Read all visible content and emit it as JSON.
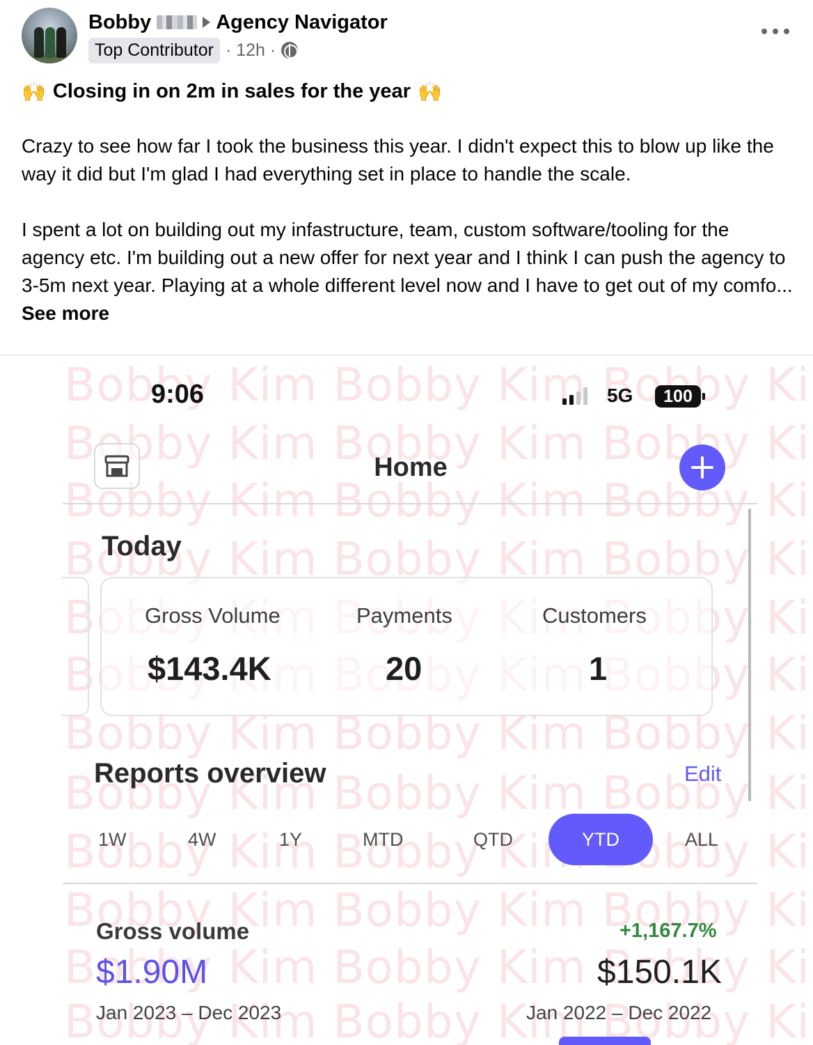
{
  "post": {
    "author": "Bobby",
    "group": "Agency Navigator",
    "badge": "Top Contributor",
    "time": "· 12h ·",
    "title": "Closing in on 2m in sales for the year",
    "title_emoji": "🙌",
    "paragraph1": "Crazy to see how far I took the business this year. I didn't expect this to blow up like the way it did but I'm glad I had everything set in place to handle the scale.",
    "paragraph2": "I spent a lot on building out my infastructure, team, custom software/tooling for the agency etc. I'm building out a new offer for next year and I think I can push the agency to 3-5m next year. Playing at a whole different level now and I have to get out of my comfo...",
    "see_more": "See more"
  },
  "screenshot": {
    "watermark": "Bobby Kim Bobby Kim Bobby Kim",
    "status": {
      "time": "9:06",
      "network": "5G",
      "battery": "100"
    },
    "header": {
      "title": "Home"
    },
    "today": {
      "title": "Today",
      "metrics": [
        {
          "label": "Gross Volume",
          "value": "$143.4K"
        },
        {
          "label": "Payments",
          "value": "20"
        },
        {
          "label": "Customers",
          "value": "1"
        }
      ]
    },
    "reports": {
      "title": "Reports overview",
      "edit": "Edit",
      "tabs": [
        "1W",
        "4W",
        "1Y",
        "MTD",
        "QTD",
        "YTD",
        "ALL"
      ],
      "active_tab": "YTD"
    },
    "gross_volume": {
      "label": "Gross volume",
      "change": "+1,167.7%",
      "current": "$1.90M",
      "previous": "$150.1K",
      "current_range": "Jan 2023 – Dec 2023",
      "previous_range": "Jan 2022 – Dec 2022"
    }
  },
  "colors": {
    "accent": "#625afa",
    "positive": "#2f8a3e",
    "watermark": "#e7828c"
  },
  "icons": [
    "more-options-icon",
    "globe-icon",
    "store-icon",
    "add-icon"
  ]
}
